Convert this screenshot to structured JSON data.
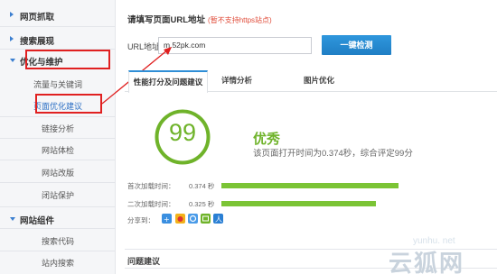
{
  "sidebar": {
    "groups": [
      {
        "label": "网页抓取",
        "expanded": false
      },
      {
        "label": "搜索展现",
        "expanded": false
      },
      {
        "label": "优化与维护",
        "expanded": true
      },
      {
        "label": "网站组件",
        "expanded": true
      }
    ],
    "items": [
      {
        "label": "流量与关键词",
        "active": false
      },
      {
        "label": "页面优化建议",
        "active": true
      },
      {
        "label": "链接分析",
        "active": false
      },
      {
        "label": "网站体检",
        "active": false
      },
      {
        "label": "网站改版",
        "active": false
      },
      {
        "label": "闭站保护",
        "active": false
      },
      {
        "label": "搜索代码",
        "active": false
      },
      {
        "label": "站内搜索",
        "active": false
      }
    ]
  },
  "form": {
    "heading": "请填写页面URL地址",
    "warning": "(暂不支持https站点)",
    "url_label": "URL地址",
    "url_value": "m.52pk.com",
    "check_button": "一键检测"
  },
  "tabs": [
    {
      "label": "性能打分及问题建议",
      "active": true
    },
    {
      "label": "详情分析",
      "active": false
    },
    {
      "label": "图片优化",
      "active": false
    }
  ],
  "result": {
    "score": "99",
    "verdict": "优秀",
    "description": "该页面打开时间为0.374秒，综合评定99分",
    "metrics": [
      {
        "label": "首次加载时间：",
        "value": "0.374 秒",
        "fraction": 1.0
      },
      {
        "label": "二次加载时间：",
        "value": "0.325 秒",
        "fraction": 0.87
      }
    ],
    "share_label": "分享到：",
    "share_icons": [
      "qzone-icon",
      "weibo-icon",
      "tencent-weibo-icon",
      "douban-icon",
      "renren-icon"
    ]
  },
  "issues": {
    "title": "问题建议"
  },
  "watermark": {
    "url": "yunhu. net",
    "brand": "云狐网"
  },
  "colors": {
    "accent_blue": "#2f8ed6",
    "score_green": "#6fb32a",
    "bar_green": "#7bc435",
    "annotation_red": "#e02020",
    "warning_red": "#e04c3a"
  }
}
